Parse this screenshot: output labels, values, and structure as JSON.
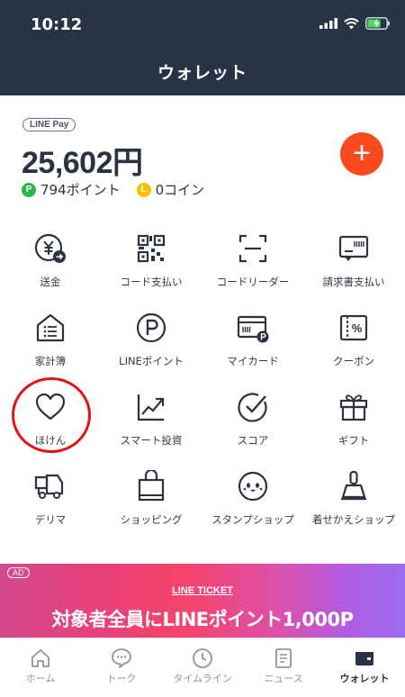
{
  "status": {
    "time": "10:12"
  },
  "header": {
    "title": "ウォレット"
  },
  "wallet": {
    "badge": "LINE Pay",
    "balance": "25,602円",
    "points_icon": "P",
    "points": "794ポイント",
    "coins_icon": "L",
    "coins": "0コイン",
    "add_button": "+"
  },
  "grid": [
    {
      "label": "送金",
      "icon": "send-money-icon"
    },
    {
      "label": "コード支払い",
      "icon": "qr-code-icon"
    },
    {
      "label": "コードリーダー",
      "icon": "code-reader-icon"
    },
    {
      "label": "請求書支払い",
      "icon": "invoice-icon"
    },
    {
      "label": "家計簿",
      "icon": "household-book-icon"
    },
    {
      "label": "LINEポイント",
      "icon": "line-points-icon"
    },
    {
      "label": "マイカード",
      "icon": "my-card-icon"
    },
    {
      "label": "クーポン",
      "icon": "coupon-icon"
    },
    {
      "label": "ほけん",
      "icon": "heart-icon"
    },
    {
      "label": "スマート投資",
      "icon": "investment-chart-icon"
    },
    {
      "label": "スコア",
      "icon": "score-check-icon"
    },
    {
      "label": "ギフト",
      "icon": "gift-icon"
    },
    {
      "label": "デリマ",
      "icon": "delivery-truck-icon"
    },
    {
      "label": "ショッピング",
      "icon": "shopping-bag-icon"
    },
    {
      "label": "スタンプショップ",
      "icon": "sticker-face-icon"
    },
    {
      "label": "着せかえショップ",
      "icon": "brush-icon"
    }
  ],
  "banner": {
    "ad_label": "AD",
    "ticket": "LINE TICKET",
    "headline": "対象者全員にLINEポイント1,000P"
  },
  "tabs": [
    {
      "label": "ホーム",
      "icon": "home-icon"
    },
    {
      "label": "トーク",
      "icon": "chat-icon"
    },
    {
      "label": "タイムライン",
      "icon": "clock-icon"
    },
    {
      "label": "ニュース",
      "icon": "news-icon"
    },
    {
      "label": "ウォレット",
      "icon": "wallet-icon",
      "active": true
    }
  ],
  "colors": {
    "header": "#283346",
    "accent": "#fb4b1e",
    "points": "#2bb64a",
    "coin": "#f3c300",
    "annotation": "#e01616"
  }
}
